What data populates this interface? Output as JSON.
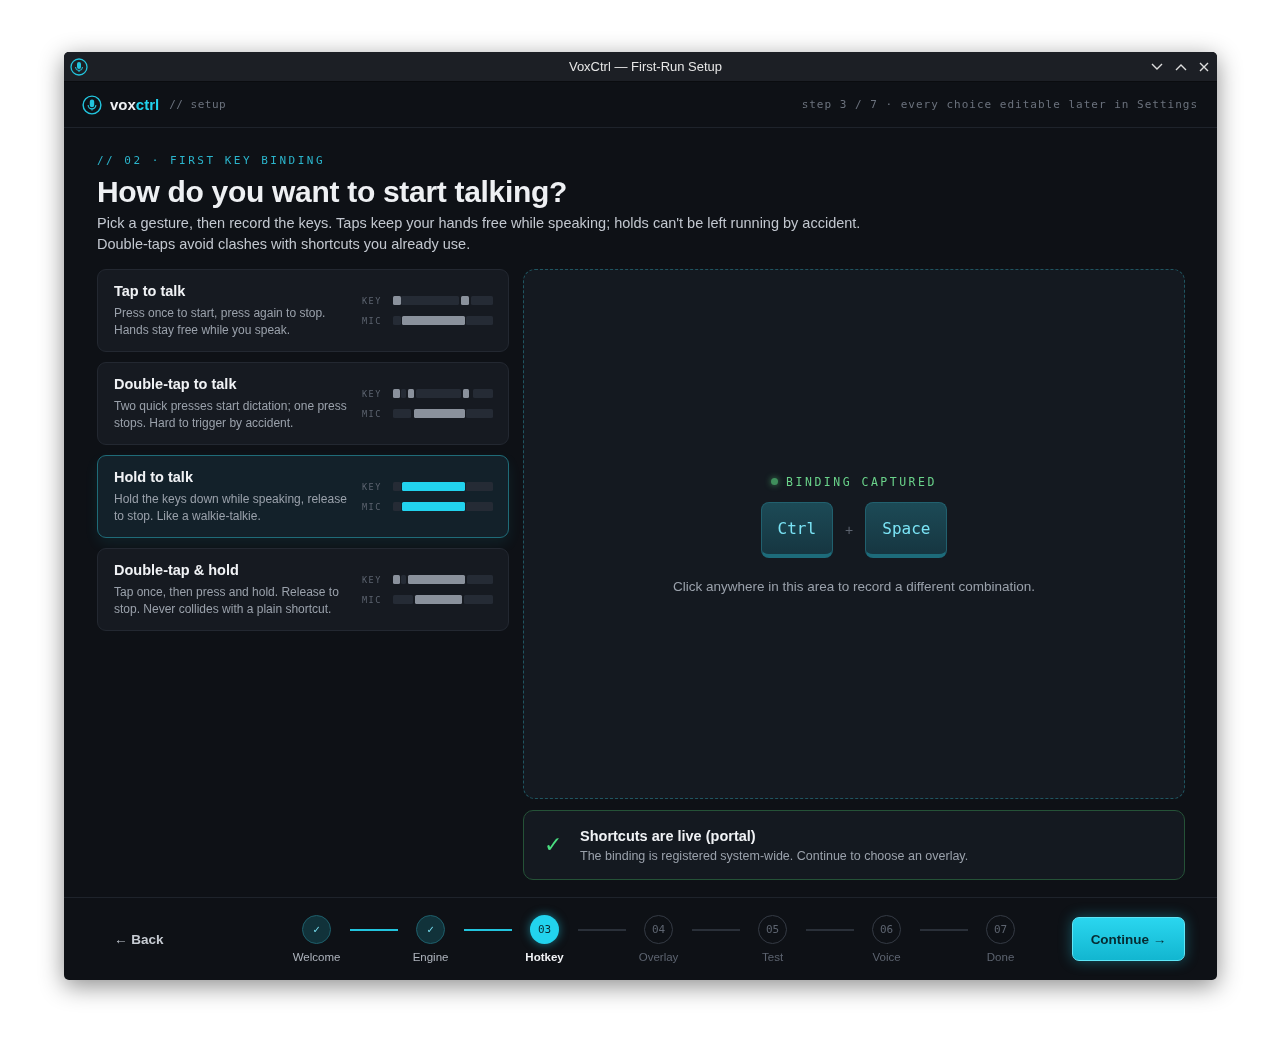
{
  "window": {
    "title": "VoxCtrl — First-Run Setup"
  },
  "header": {
    "brand_a": "vox",
    "brand_b": "ctrl",
    "path": "// setup",
    "step_note": "step 3 / 7 · every choice editable later in Settings"
  },
  "section": {
    "eyebrow": "// 02 · FIRST KEY BINDING",
    "heading": "How do you want to start talking?",
    "intro": "Pick a gesture, then record the keys. Taps keep your hands free while speaking; holds can't be left running by accident. Double-taps avoid clashes with shortcuts you already use."
  },
  "options": [
    {
      "kind": "tap",
      "title": "Tap to talk",
      "description": "Press once to start, press again to stop. Hands stay free while you speak.",
      "key_label": "KEY",
      "mic_label": "MIC",
      "selected": false
    },
    {
      "kind": "double_tap",
      "title": "Double-tap to talk",
      "description": "Two quick presses start dictation; one press stops. Hard to trigger by accident.",
      "key_label": "KEY",
      "mic_label": "MIC",
      "selected": false
    },
    {
      "kind": "hold",
      "title": "Hold to talk",
      "description": "Hold the keys down while speaking, release to stop. Like a walkie-talkie.",
      "key_label": "KEY",
      "mic_label": "MIC",
      "selected": true
    },
    {
      "kind": "double_tap_hold",
      "title": "Double-tap & hold",
      "description": "Tap once, then press and hold. Release to stop. Never collides with a plain shortcut.",
      "key_label": "KEY",
      "mic_label": "MIC",
      "selected": false
    }
  ],
  "binding": {
    "status": "BINDING CAPTURED",
    "captured": true,
    "keys": [
      "Ctrl",
      "Space"
    ],
    "separator": "+",
    "hint": "Click anywhere in this area to record a different combination."
  },
  "notice": {
    "mark": "✓",
    "title": "Shortcuts are live (portal)",
    "text": "The binding is registered system-wide. Continue to choose an overlay."
  },
  "footer": {
    "back": "← Back",
    "continue": "Continue →",
    "steps": [
      {
        "mark": "✓",
        "label": "Welcome",
        "done": true,
        "selected": false
      },
      {
        "mark": "✓",
        "label": "Engine",
        "done": true,
        "selected": false
      },
      {
        "mark": "03",
        "label": "Hotkey",
        "done": false,
        "selected": true
      },
      {
        "mark": "04",
        "label": "Overlay",
        "done": false,
        "selected": false
      },
      {
        "mark": "05",
        "label": "Test",
        "done": false,
        "selected": false
      },
      {
        "mark": "06",
        "label": "Voice",
        "done": false,
        "selected": false
      },
      {
        "mark": "07",
        "label": "Done",
        "done": false,
        "selected": false
      }
    ]
  }
}
